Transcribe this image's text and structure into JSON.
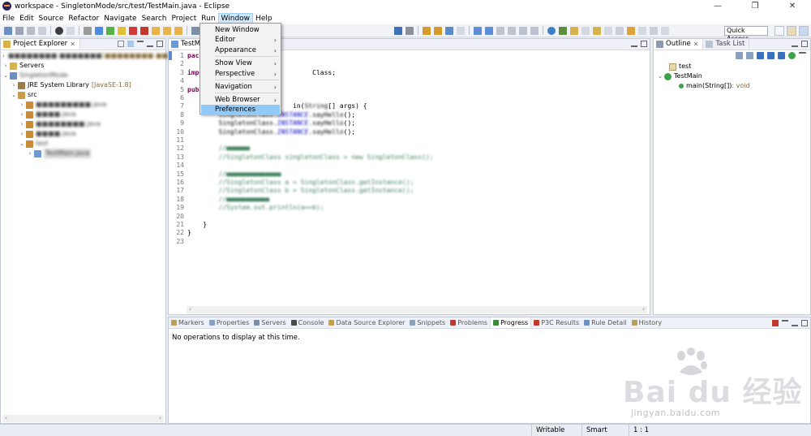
{
  "window": {
    "title": "workspace - SingletonMode/src/test/TestMain.java - Eclipse",
    "controls": [
      "—",
      "❐",
      "✕"
    ]
  },
  "menubar": {
    "items": [
      "File",
      "Edit",
      "Source",
      "Refactor",
      "Navigate",
      "Search",
      "Project",
      "Run",
      "Window",
      "Help"
    ],
    "active": "Window"
  },
  "toolbar": {
    "quick_access": "Quick Access"
  },
  "window_menu": {
    "items": [
      {
        "label": "New Window",
        "submenu": false
      },
      {
        "label": "Editor",
        "submenu": true
      },
      {
        "label": "Appearance",
        "submenu": true
      },
      {
        "label": "Show View",
        "submenu": true
      },
      {
        "label": "Perspective",
        "submenu": true
      },
      {
        "label": "Navigation",
        "submenu": true
      },
      {
        "label": "Web Browser",
        "submenu": true
      },
      {
        "label": "Preferences",
        "submenu": false
      }
    ],
    "highlighted": "Preferences",
    "arrow_glyph": "›"
  },
  "project_explorer": {
    "tab_label": "Project Explorer",
    "close_glyph": "✕",
    "rows": [
      {
        "text": "■■■■■■■■ ■■■■■■■",
        "suffix": "[■■■■■■■■ ■■■■■■■ ■■]",
        "blurred": true
      },
      {
        "text": "Servers",
        "blurred": false
      },
      {
        "text": "SingletonMode",
        "blurred": true
      },
      {
        "text": "JRE System Library",
        "suffix": "[JavaSE-1.8]",
        "blurred": false
      },
      {
        "text": "src",
        "blurred": false
      },
      {
        "text": "■■■■■■■■■.java",
        "blurred": true
      },
      {
        "text": "■■■■.java",
        "blurred": true
      },
      {
        "text": "■■■■■■■■.java",
        "blurred": true
      },
      {
        "text": "■■■■.java",
        "blurred": true
      },
      {
        "text": "test",
        "blurred": true
      },
      {
        "text": "TestMain.java",
        "blurred": true
      }
    ]
  },
  "editor": {
    "tab_label": "TestMain.java",
    "tab_label_visible": "TestMa",
    "lines": [
      {
        "n": "1",
        "segments": [
          {
            "t": "pack",
            "c": "kw"
          }
        ]
      },
      {
        "n": "2",
        "segments": []
      },
      {
        "n": "3",
        "segments": [
          {
            "t": "impo",
            "c": "kw"
          },
          {
            "t": "                            Class;",
            "c": ""
          }
        ]
      },
      {
        "n": "4",
        "segments": []
      },
      {
        "n": "5",
        "segments": [
          {
            "t": "publ",
            "c": "kw"
          }
        ]
      },
      {
        "n": "6",
        "segments": []
      },
      {
        "n": "7",
        "segments": [
          {
            "t": "                           in(",
            "c": ""
          },
          {
            "t": "String",
            "c": "bl"
          },
          {
            "t": "[] args) {",
            "c": ""
          }
        ]
      },
      {
        "n": "8",
        "segments": [
          {
            "t": "        ",
            "c": ""
          },
          {
            "t": "SingletonClass.",
            "c": "bl"
          },
          {
            "t": "INSTANCE",
            "c": "fld"
          },
          {
            "t": ".sayHello",
            "c": "bl"
          },
          {
            "t": "();",
            "c": ""
          }
        ]
      },
      {
        "n": "9",
        "segments": [
          {
            "t": "        ",
            "c": ""
          },
          {
            "t": "SingletonClass.",
            "c": "bl"
          },
          {
            "t": "INSTANCE",
            "c": "fld"
          },
          {
            "t": ".sayHello",
            "c": "bl"
          },
          {
            "t": "();",
            "c": ""
          }
        ]
      },
      {
        "n": "10",
        "segments": [
          {
            "t": "        ",
            "c": ""
          },
          {
            "t": "SingletonClass.",
            "c": "bl"
          },
          {
            "t": "INSTANCE",
            "c": "fld"
          },
          {
            "t": ".sayHello",
            "c": "bl"
          },
          {
            "t": "();",
            "c": ""
          }
        ]
      },
      {
        "n": "11",
        "segments": []
      },
      {
        "n": "12",
        "segments": [
          {
            "t": "        //■■■■■■",
            "c": "cm"
          }
        ]
      },
      {
        "n": "13",
        "segments": [
          {
            "t": "        //SingletonClass singletonClass = new SingletonClass();",
            "c": "cm"
          }
        ]
      },
      {
        "n": "14",
        "segments": []
      },
      {
        "n": "15",
        "segments": [
          {
            "t": "        //■■■■■■■■■■■■■■",
            "c": "cm"
          }
        ]
      },
      {
        "n": "16",
        "segments": [
          {
            "t": "        //SingletonClass a = SingletonClass.getInstance();",
            "c": "cm"
          }
        ]
      },
      {
        "n": "17",
        "segments": [
          {
            "t": "        //SingletonClass b = SingletonClass.getInstance();",
            "c": "cm"
          }
        ]
      },
      {
        "n": "18",
        "segments": [
          {
            "t": "        //■■■■■■■■■■■",
            "c": "cm"
          }
        ]
      },
      {
        "n": "19",
        "segments": [
          {
            "t": "        //System.out.println(a==b);",
            "c": "cm"
          }
        ]
      },
      {
        "n": "20",
        "segments": []
      },
      {
        "n": "21",
        "segments": [
          {
            "t": "    }",
            "c": ""
          }
        ]
      },
      {
        "n": "22",
        "segments": [
          {
            "t": "}",
            "c": ""
          }
        ]
      },
      {
        "n": "23",
        "segments": []
      }
    ]
  },
  "outline": {
    "tabs": [
      "Outline",
      "Task List"
    ],
    "close_glyph": "✕",
    "rows": [
      {
        "text": "test",
        "suffix": ""
      },
      {
        "text": "TestMain",
        "suffix": ""
      },
      {
        "text": "main(String[])",
        "suffix": " : void"
      }
    ]
  },
  "bottom_panel": {
    "tabs": [
      "Markers",
      "Properties",
      "Servers",
      "Console",
      "Data Source Explorer",
      "Snippets",
      "Problems",
      "Progress",
      "P3C Results",
      "Rule Detail",
      "History"
    ],
    "active_tab": "Progress",
    "message": "No operations to display at this time."
  },
  "statusbar": {
    "mode": "Writable",
    "insert": "Smart Insert",
    "position": "1 : 1"
  },
  "watermark": {
    "brand": "Bai du 经验",
    "url": "jingyan.baidu.com"
  },
  "colors": {
    "menu_highlight": "#91c9f7",
    "keyword": "#7f0055",
    "comment": "#3f7f5f",
    "field": "#0000c0"
  }
}
